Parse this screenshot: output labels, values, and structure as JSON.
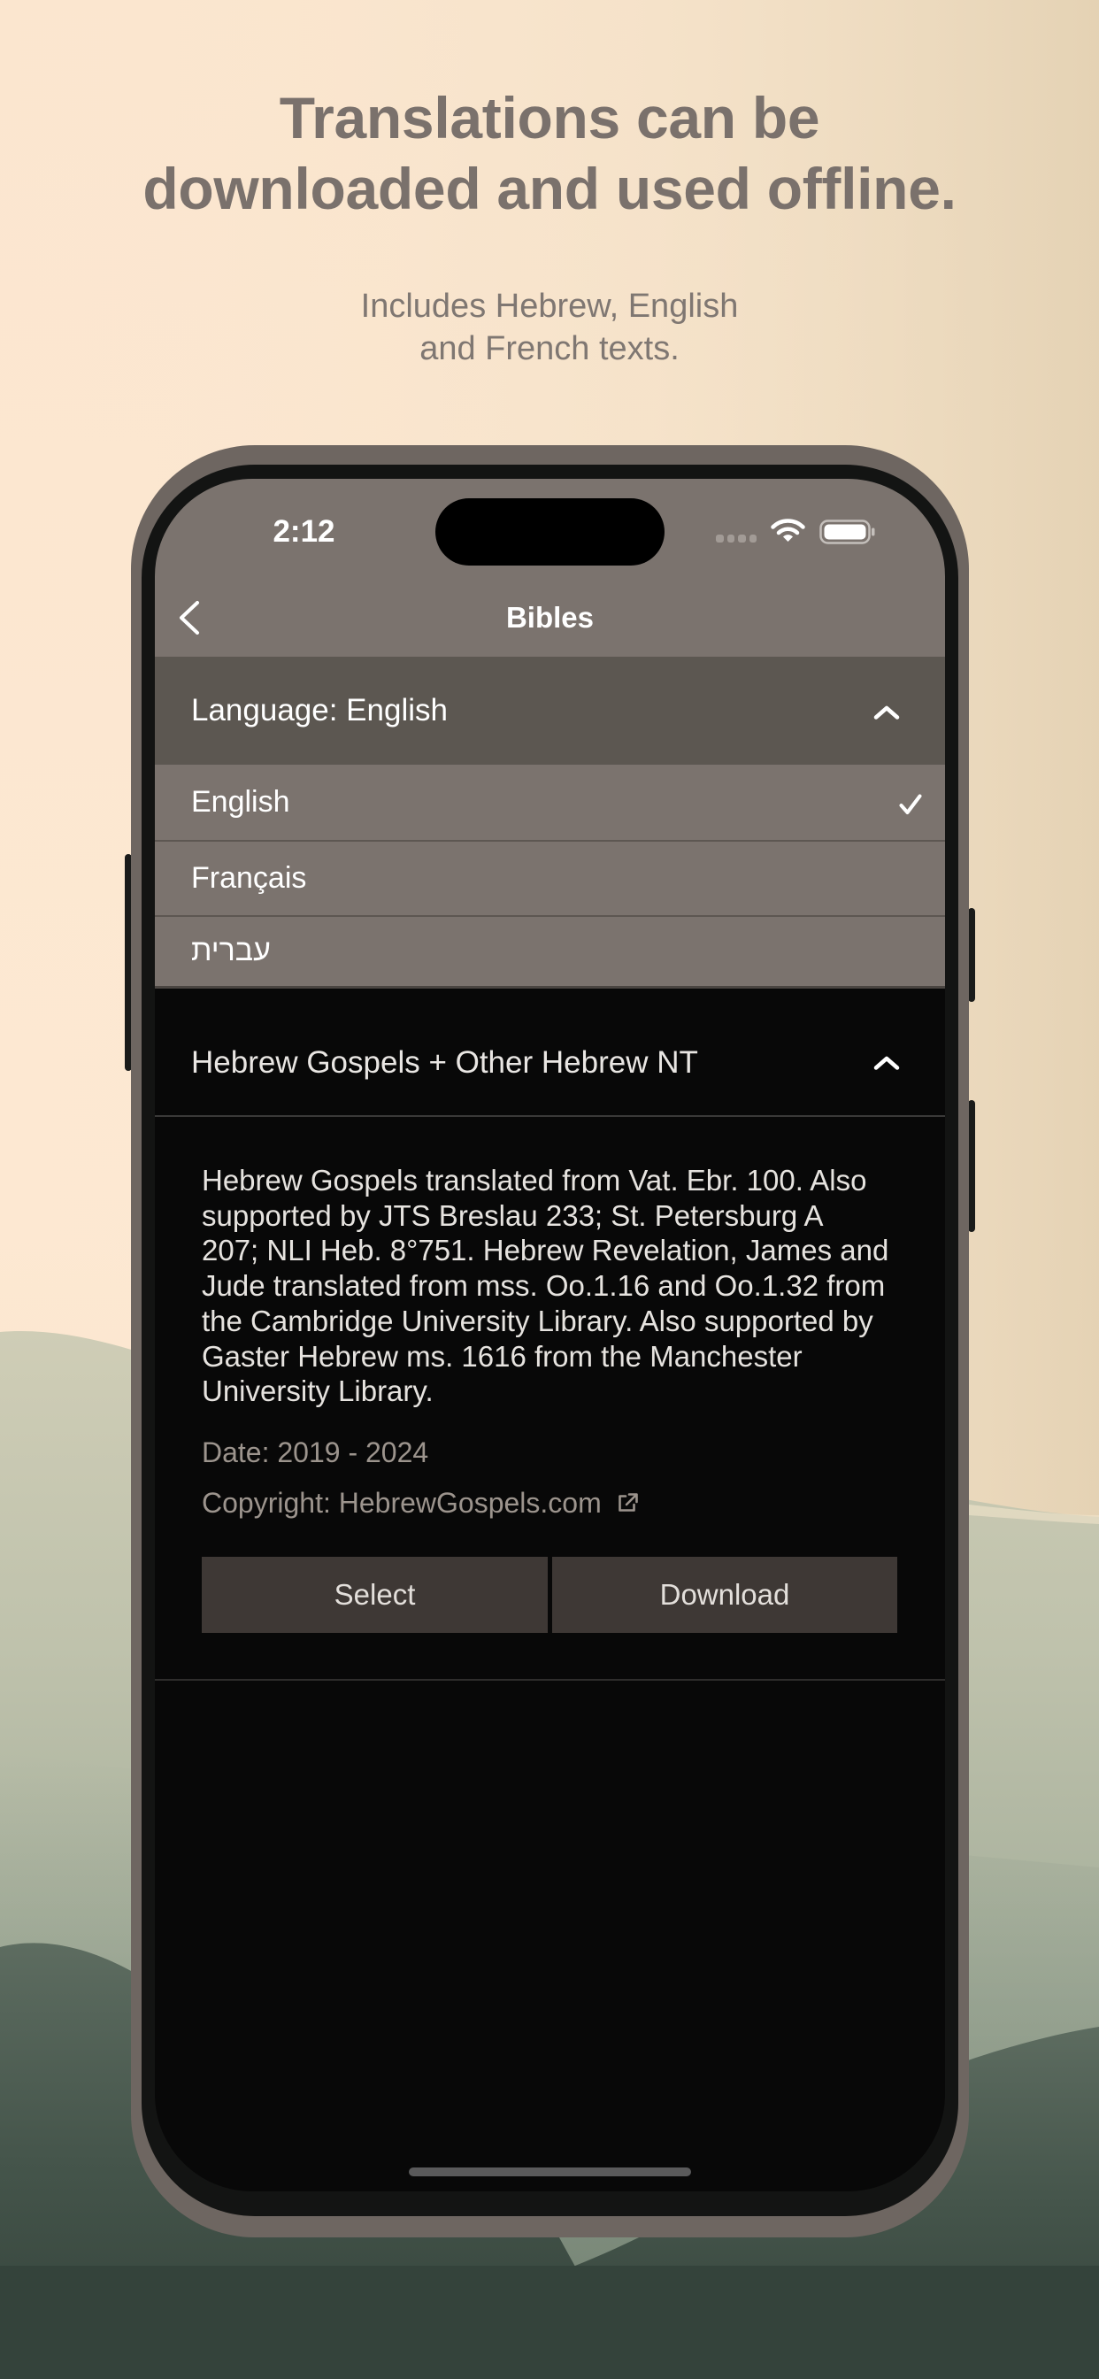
{
  "marketing": {
    "headline_lines": [
      "Translations can be",
      "downloaded and used offline."
    ],
    "subheadline_lines": [
      "Includes Hebrew, English",
      "and French texts."
    ]
  },
  "status_bar": {
    "time": "2:12",
    "icons": [
      "cellular-signal-icon",
      "wifi-icon",
      "battery-icon"
    ]
  },
  "nav": {
    "title": "Bibles",
    "back_icon": "chevron-left-icon"
  },
  "language_picker": {
    "label": "Language: English",
    "expanded": true,
    "toggle_icon": "chevron-up-icon",
    "options": [
      {
        "label": "English",
        "selected": true
      },
      {
        "label": "Français",
        "selected": false
      },
      {
        "label": "עברית",
        "selected": false
      }
    ],
    "selected_icon": "checkmark-icon"
  },
  "translation": {
    "title": "Hebrew Gospels + Other Hebrew NT",
    "expanded": true,
    "description_lines": [
      "Hebrew Gospels translated from Vat. Ebr. 100. Also",
      "supported by JTS Breslau 233; St. Petersburg A",
      "207; NLI Heb. 8°751. Hebrew Revelation, James and",
      "Jude translated from mss. Oo.1.16 and Oo.1.32 from",
      "the Cambridge University Library. Also supported by",
      "Gaster Hebrew ms. 1616 from the Manchester",
      "University Library."
    ],
    "date": "Date: 2019 - 2024",
    "copyright": "Copyright: HebrewGospels.com",
    "copyright_icon": "external-link-icon",
    "buttons": {
      "select": "Select",
      "download": "Download"
    }
  },
  "colors": {
    "headline_text": "#7a716c",
    "nav_background": "#7b736e",
    "dropdown_header_background": "#5c5751",
    "content_background": "#080808",
    "button_background": "#3e3835",
    "meta_text": "#9c948d",
    "phone_frame": "#6e6661"
  }
}
